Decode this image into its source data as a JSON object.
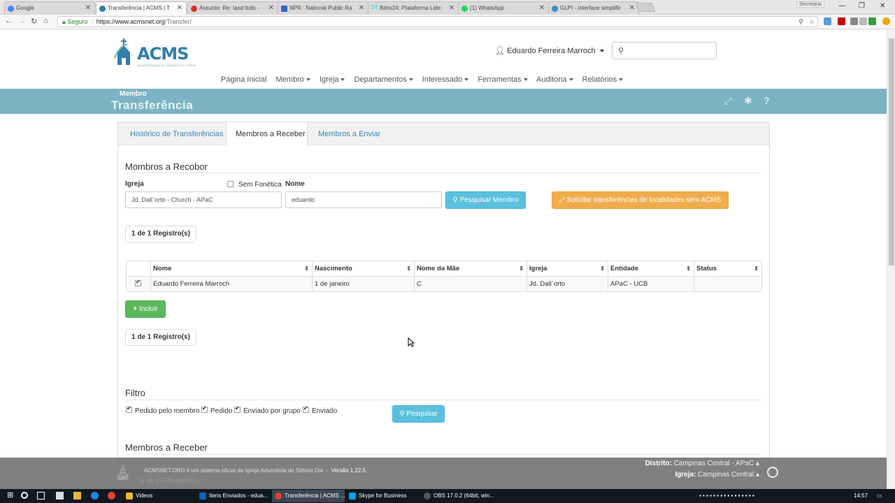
{
  "browser": {
    "tabs": [
      {
        "title": "Google",
        "color": "#4285f4"
      },
      {
        "title": "Transferência | ACMS | T",
        "color": "#2f7fa8"
      },
      {
        "title": "Assunto: Re: Iasd Itobi - ",
        "color": "#d93025"
      },
      {
        "title": "NPR : National Public Ra",
        "color": "#3366cc"
      },
      {
        "title": "Bitrix24: Plataforma Lide",
        "color": "#2fc7f7"
      },
      {
        "title": "(1) WhatsApp",
        "color": "#25d366"
      },
      {
        "title": "GLPI - Interface simplific",
        "color": "#3a8ec7"
      }
    ],
    "tab_number_prefix": "24",
    "profile": "Secretaria",
    "secure_label": "Seguro",
    "url_host": "https://www.acmsnet.org",
    "url_path": "/Transfer/"
  },
  "header": {
    "logo_text": "ACMS",
    "logo_sub": "ADMINISTRAÇÃO DE MEMBROS DA IGREJA",
    "user_name": "Eduardo Ferreira Marroch",
    "search_placeholder": ""
  },
  "nav": {
    "items": [
      {
        "label": "Página Inicial",
        "dropdown": false
      },
      {
        "label": "Membro",
        "dropdown": true
      },
      {
        "label": "Igreja",
        "dropdown": true
      },
      {
        "label": "Departamentos",
        "dropdown": true
      },
      {
        "label": "Interessado",
        "dropdown": true
      },
      {
        "label": "Ferramentas",
        "dropdown": true
      },
      {
        "label": "Auditoria",
        "dropdown": true
      },
      {
        "label": "Relatórios",
        "dropdown": true
      }
    ]
  },
  "page": {
    "breadcrumb": "Membro",
    "title": "Transferência"
  },
  "card_tabs": [
    "Histórico de Transferências",
    "Membros a Receber",
    "Membros a Enviar"
  ],
  "search_form": {
    "section_title": "Mombros a Recobor",
    "igreja_label": "Igreja",
    "igreja_value": "Jd. Dall`orto - Church - APaC",
    "sem_fonetica_label": "Sem Fonética",
    "sem_fonetica_checked": false,
    "nome_label": "Nome",
    "nome_value": "eduardo",
    "search_button": "Pesquisar Membro",
    "request_button": "Solicitar transferências de localidades sem ACMS"
  },
  "pager_top": "1 de 1 Registro(s)",
  "pager_bottom": "1 de 1 Registro(s)",
  "table": {
    "headers": [
      "Nome",
      "Nascimento",
      "Nome da Mãe",
      "Igreja",
      "Entidade",
      "Status"
    ],
    "rows": [
      {
        "checked": true,
        "cells": [
          "Eduardo Ferreira Marroch",
          "1 de janeiro",
          "C",
          "Jd. Dall`orto",
          "APaC - UCB",
          ""
        ]
      }
    ]
  },
  "include_button": "Incluir",
  "filter": {
    "title": "Filtro",
    "options": [
      {
        "label": "Pedido pelo membro",
        "checked": true
      },
      {
        "label": "Pedido",
        "checked": true
      },
      {
        "label": "Enviado por grupo",
        "checked": true
      },
      {
        "label": "Enviado",
        "checked": true
      }
    ],
    "button": "Pesquisar"
  },
  "lower_section_title": "Membros a Receber",
  "footer": {
    "text": "ACMSNET.ORG é um sistema oficial da Igreja Adventista do Sétimo Dia",
    "version": "Versão 1.22.5",
    "distrito_label": "Distrito:",
    "distrito_value": "Campinas Central - APaC",
    "igreja_label": "Igreja:",
    "igreja_value": "Campinas Central",
    "ghost_text": "1 de 10 Registro(s)"
  },
  "taskbar": {
    "items": [
      {
        "label": "Videos",
        "color": "#e8b830"
      },
      {
        "label": "Itens Enviados - edua...",
        "color": "#0f62b5"
      },
      {
        "label": "Transferência | ACMS ...",
        "color": "#e34133"
      },
      {
        "label": "Skype for Business",
        "color": "#00a2ed"
      },
      {
        "label": "OBS 17.0.2 (64bit, win...",
        "color": "#555555"
      }
    ],
    "clock": "14:57"
  },
  "colors": {
    "accent": "#5bc0de",
    "warning": "#f0ad4e",
    "success": "#5cb85c",
    "band": "#7cb3c3",
    "link": "#3a87b4"
  }
}
